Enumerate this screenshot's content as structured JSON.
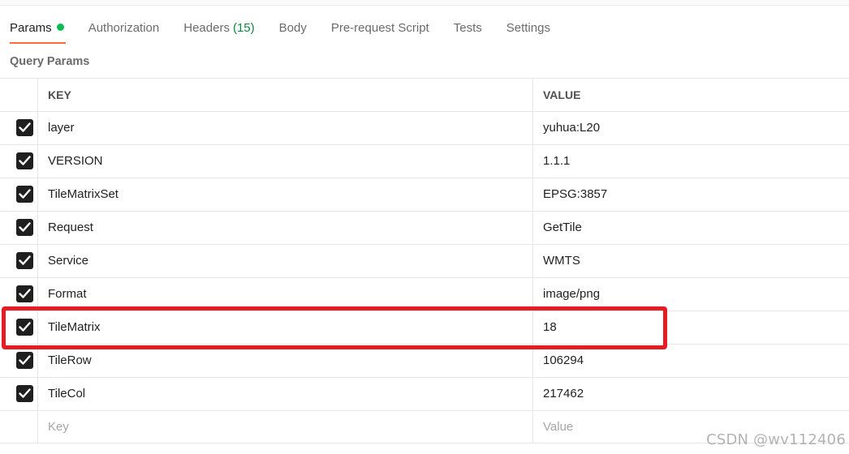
{
  "tabs": [
    {
      "label": "Params",
      "active": true,
      "indicator": "green-dot"
    },
    {
      "label": "Authorization"
    },
    {
      "label": "Headers",
      "count": "(15)"
    },
    {
      "label": "Body"
    },
    {
      "label": "Pre-request Script"
    },
    {
      "label": "Tests"
    },
    {
      "label": "Settings"
    }
  ],
  "section_title": "Query Params",
  "table": {
    "headers": {
      "key": "KEY",
      "value": "VALUE"
    },
    "rows": [
      {
        "checked": true,
        "key": "layer",
        "value": "yuhua:L20"
      },
      {
        "checked": true,
        "key": "VERSION",
        "value": "1.1.1"
      },
      {
        "checked": true,
        "key": "TileMatrixSet",
        "value": "EPSG:3857"
      },
      {
        "checked": true,
        "key": "Request",
        "value": "GetTile"
      },
      {
        "checked": true,
        "key": "Service",
        "value": "WMTS"
      },
      {
        "checked": true,
        "key": "Format",
        "value": "image/png"
      },
      {
        "checked": true,
        "key": "TileMatrix",
        "value": "18"
      },
      {
        "checked": true,
        "key": "TileRow",
        "value": "106294"
      },
      {
        "checked": true,
        "key": "TileCol",
        "value": "217462"
      }
    ],
    "new_row": {
      "key_placeholder": "Key",
      "value_placeholder": "Value"
    }
  },
  "watermark": "CSDN @wv112406",
  "colors": {
    "accent_underline": "#ff6c37",
    "status_dot": "#0cbb52",
    "highlight": "#e61b23",
    "checkbox": "#1f1f1f"
  }
}
